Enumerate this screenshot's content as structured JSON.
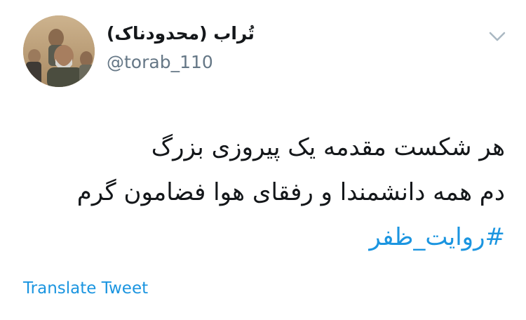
{
  "user": {
    "display_name": "تُراب (محدودناک)",
    "handle": "@torab_110"
  },
  "tweet": {
    "lines": [
      "هر شکست مقدمه یک پیروزی بزرگ",
      "دم همه دانشمندا و رفقای هوا فضامون گرم"
    ],
    "hashtag": "#روایت_ظفر"
  },
  "actions": {
    "translate_label": "Translate Tweet",
    "menu_icon": "chevron-down-icon"
  },
  "colors": {
    "link": "#1b95e0",
    "text": "#14171a",
    "secondary": "#657786"
  }
}
